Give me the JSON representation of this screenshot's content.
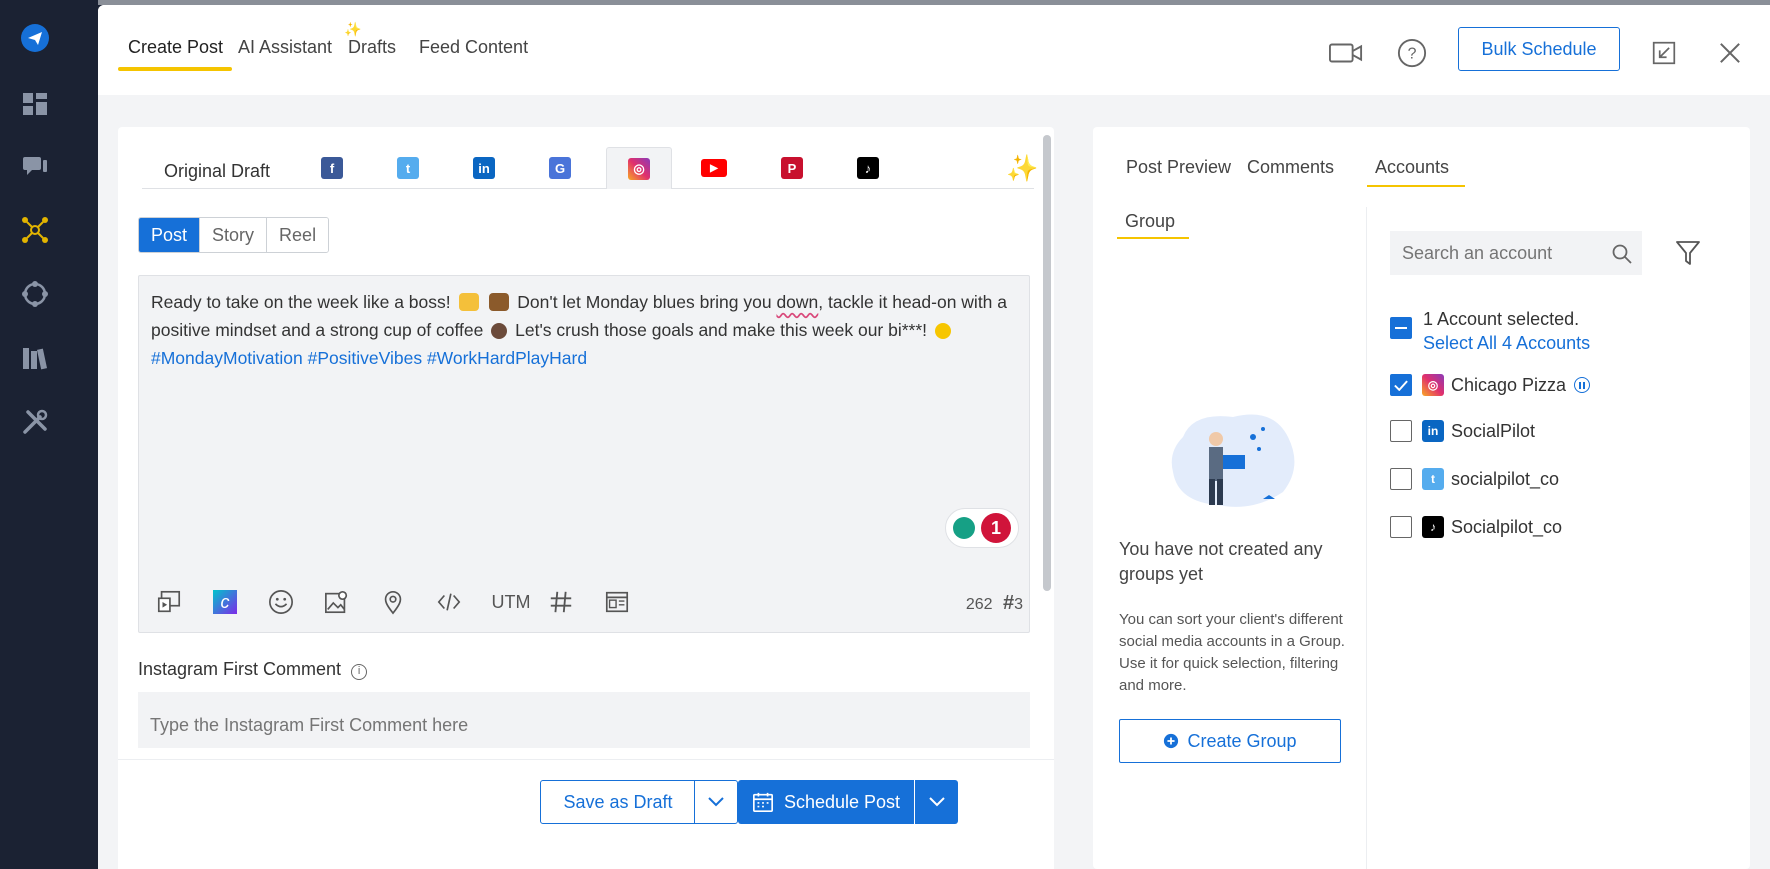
{
  "header": {
    "tabs": [
      {
        "label": "Create Post"
      },
      {
        "label": "AI Assistant"
      },
      {
        "label": "Drafts"
      },
      {
        "label": "Feed Content"
      }
    ],
    "bulk_schedule_label": "Bulk Schedule"
  },
  "editor": {
    "original_draft_label": "Original Draft",
    "network_tabs": [
      "facebook-icon",
      "twitter-icon",
      "linkedin-icon",
      "google-business-icon",
      "instagram-icon",
      "youtube-icon",
      "pinterest-icon",
      "tiktok-icon"
    ],
    "post_types": [
      "Post",
      "Story",
      "Reel"
    ],
    "text_part1": "Ready to take on the week like a boss!",
    "text_part2": "Don't let Monday blues bring you",
    "text_word": "down",
    "text_part3": ", tackle it head-on with a positive mindset and a strong cup of coffee",
    "text_part4": "Let's crush those goals and make this week our bi***!",
    "hashtags": "#MondayMotivation #PositiveVibes #WorkHardPlayHard",
    "grammar_count": "1",
    "toolbar_utm": "UTM",
    "char_count": "262",
    "hashtag_count": "3",
    "first_comment_label": "Instagram First Comment",
    "first_comment_placeholder": "Type the Instagram First Comment here",
    "save_draft_label": "Save as Draft",
    "schedule_label": "Schedule Post"
  },
  "right": {
    "tabs": [
      "Post Preview",
      "Comments",
      "Accounts"
    ],
    "group_tab": "Group",
    "empty_title": "You have not created any groups yet",
    "empty_desc": "You can sort your client's different social media accounts in a Group. Use it for quick selection, filtering and more.",
    "create_group_label": "Create Group",
    "search_placeholder": "Search an account",
    "selected_text": "1 Account selected.",
    "select_all_text": "Select All 4 Accounts",
    "accounts": [
      {
        "name": "Chicago Pizza",
        "network": "instagram-icon",
        "checked": true
      },
      {
        "name": "SocialPilot",
        "network": "linkedin-icon",
        "checked": false
      },
      {
        "name": "socialpilot_co",
        "network": "twitter-icon",
        "checked": false
      },
      {
        "name": "Socialpilot_co",
        "network": "tiktok-icon",
        "checked": false
      }
    ]
  },
  "colors": {
    "accent": "#1670d8",
    "sidebar": "#1b2233",
    "tab_underline": "#f5c400"
  }
}
